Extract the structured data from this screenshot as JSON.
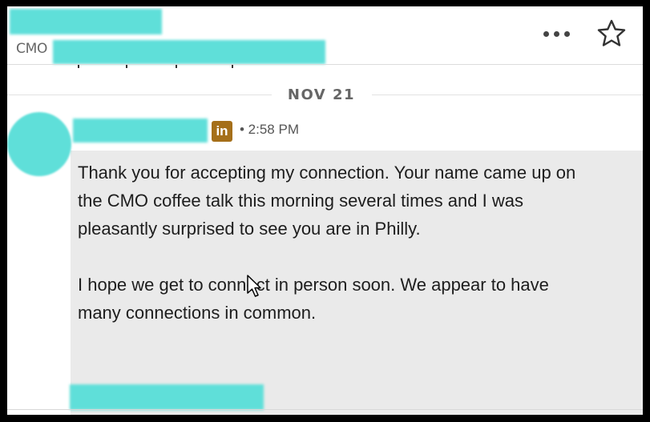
{
  "header": {
    "contact_subtitle_prefix": "CMO",
    "icons": [
      "more-options-icon",
      "star-icon"
    ]
  },
  "conversation": {
    "date_divider": "NOV 21",
    "message": {
      "source_badge": "in",
      "time": "• 2:58 PM",
      "paragraphs": [
        "Thank you for accepting my connection. Your name came up on the CMO coffee talk this morning several times and I was pleasantly surprised to see you are in Philly.",
        "I hope we get to connect in person soon. We appear to have many connections in common."
      ]
    }
  },
  "colors": {
    "redaction": "#5fdfd9",
    "bubble_bg": "#eaeaea",
    "linkedin_badge": "#a56f1a"
  }
}
